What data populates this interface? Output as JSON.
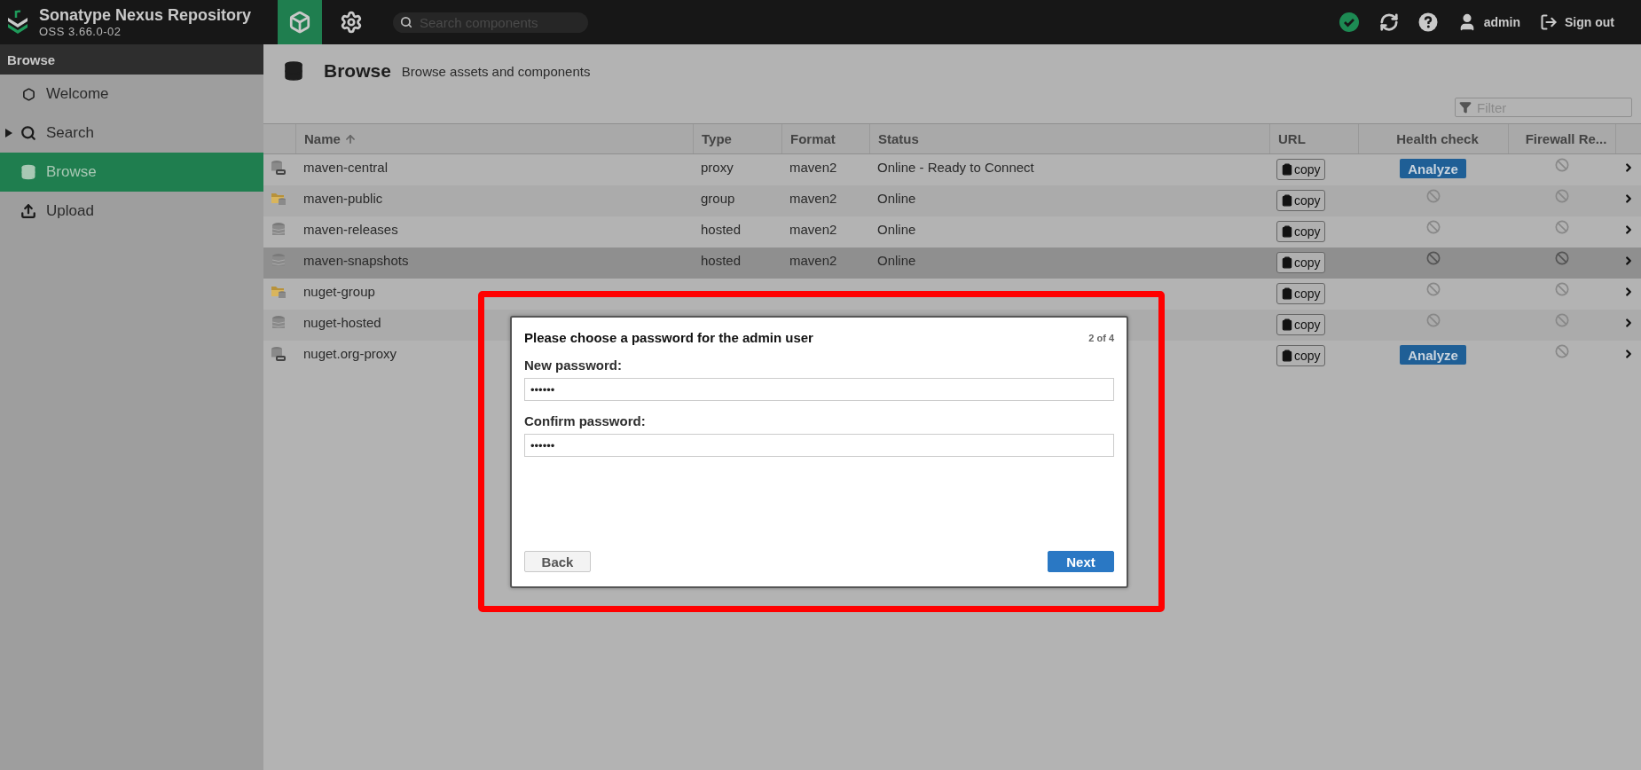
{
  "app": {
    "title": "Sonatype Nexus Repository",
    "version": "OSS 3.66.0-02"
  },
  "nav": [
    {
      "kind": "browse",
      "selected": true
    },
    {
      "kind": "admin",
      "selected": false
    }
  ],
  "search": {
    "placeholder": "Search components"
  },
  "user": {
    "name": "admin",
    "sign_out": "Sign out"
  },
  "sidebar": {
    "title": "Browse",
    "items": [
      {
        "kind": "welcome",
        "label": "Welcome",
        "selected": false
      },
      {
        "kind": "search",
        "label": "Search",
        "selected": false,
        "expanded": false
      },
      {
        "kind": "browse",
        "label": "Browse",
        "selected": true
      },
      {
        "kind": "upload",
        "label": "Upload",
        "selected": false
      }
    ]
  },
  "page": {
    "title": "Browse",
    "subtitle": "Browse assets and components",
    "filter_placeholder": "Filter"
  },
  "table": {
    "columns": [
      {
        "label": "Name",
        "sorted": true
      },
      {
        "label": "Type",
        "sorted": false
      },
      {
        "label": "Format",
        "sorted": false
      },
      {
        "label": "Status",
        "sorted": false
      },
      {
        "label": "URL",
        "sorted": false
      },
      {
        "label": "Health check",
        "sorted": false
      },
      {
        "label": "Firewall Re...",
        "sorted": false
      }
    ],
    "rows": [
      {
        "kind": "proxy",
        "name": "maven-central",
        "type": "proxy",
        "format": "maven2",
        "status": "Online - Ready to Connect",
        "url": "copy",
        "health": "Analyze",
        "selected": false
      },
      {
        "kind": "group",
        "name": "maven-public",
        "type": "group",
        "format": "maven2",
        "status": "Online",
        "url": "copy",
        "selected": false
      },
      {
        "kind": "hosted",
        "name": "maven-releases",
        "type": "hosted",
        "format": "maven2",
        "status": "Online",
        "url": "copy",
        "selected": false
      },
      {
        "kind": "hosted",
        "name": "maven-snapshots",
        "type": "hosted",
        "format": "maven2",
        "status": "Online",
        "url": "copy",
        "selected": true
      },
      {
        "kind": "group",
        "name": "nuget-group",
        "url": "copy",
        "selected": false
      },
      {
        "kind": "hosted",
        "name": "nuget-hosted",
        "url": "copy",
        "selected": false
      },
      {
        "kind": "proxy",
        "name": "nuget.org-proxy",
        "url": "copy",
        "health": "Analyze",
        "selected": false
      }
    ]
  },
  "dialog": {
    "title": "Please choose a password for the admin user",
    "step": "2 of 4",
    "fields": [
      {
        "label": "New password:",
        "value": "••••••"
      },
      {
        "label": "Confirm password:",
        "value": "••••••"
      }
    ],
    "buttons": [
      {
        "kind": "secondary",
        "label": "Back"
      },
      {
        "kind": "primary",
        "label": "Next"
      }
    ]
  }
}
